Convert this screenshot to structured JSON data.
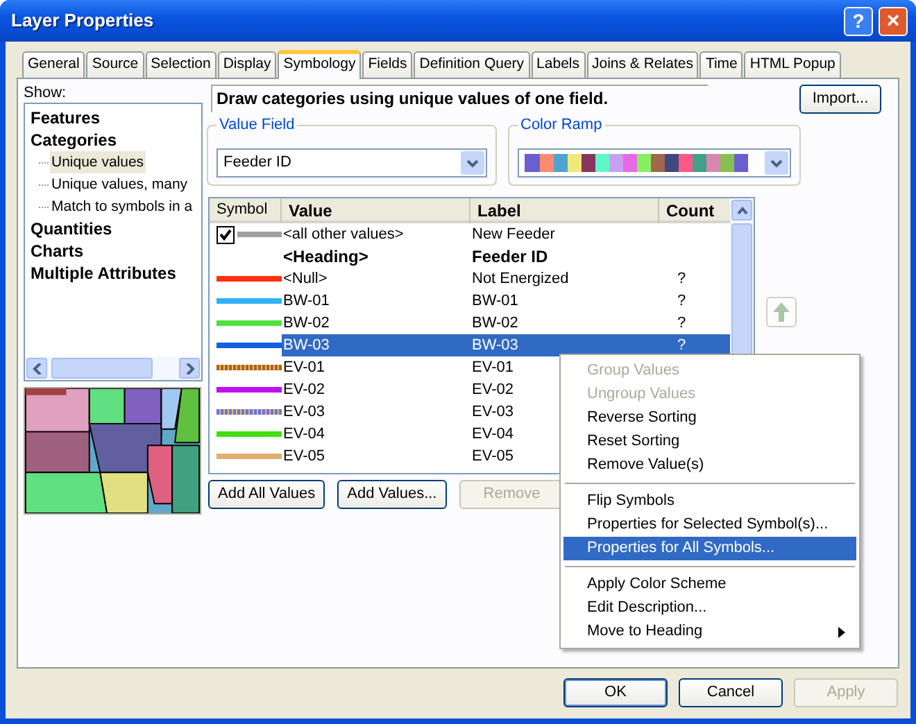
{
  "window": {
    "title": "Layer Properties",
    "help_button": "?",
    "close_button": "×"
  },
  "tabs": [
    {
      "label": "General",
      "selected": false
    },
    {
      "label": "Source",
      "selected": false
    },
    {
      "label": "Selection",
      "selected": false
    },
    {
      "label": "Display",
      "selected": false
    },
    {
      "label": "Symbology",
      "selected": true
    },
    {
      "label": "Fields",
      "selected": false
    },
    {
      "label": "Definition Query",
      "selected": false
    },
    {
      "label": "Labels",
      "selected": false
    },
    {
      "label": "Joins & Relates",
      "selected": false
    },
    {
      "label": "Time",
      "selected": false
    },
    {
      "label": "HTML Popup",
      "selected": false
    }
  ],
  "show": {
    "label": "Show:",
    "tree": [
      {
        "label": "Features",
        "selected": false
      },
      {
        "label": "Categories",
        "selected": false,
        "children": [
          {
            "label": "Unique values",
            "selected": true
          },
          {
            "label": "Unique values, many",
            "selected": false
          },
          {
            "label": "Match to symbols in a",
            "selected": false
          }
        ]
      },
      {
        "label": "Quantities",
        "selected": false
      },
      {
        "label": "Charts",
        "selected": false
      },
      {
        "label": "Multiple Attributes",
        "selected": false
      }
    ]
  },
  "description": "Draw categories using unique values of one field.",
  "import_button": "Import...",
  "value_field": {
    "legend": "Value Field",
    "value": "Feeder ID"
  },
  "color_ramp": {
    "legend": "Color Ramp",
    "swatches": [
      {
        "color": "#6a5fcf"
      },
      {
        "color": "#ff8a70"
      },
      {
        "color": "#4fa3d0"
      },
      {
        "color": "#f0e878"
      },
      {
        "color": "#8a3560"
      },
      {
        "color": "#60f8c8"
      },
      {
        "color": "#c8a0f0"
      },
      {
        "color": "#e868e8"
      },
      {
        "color": "#88f060"
      },
      {
        "color": "#a06848"
      },
      {
        "color": "#404880"
      },
      {
        "color": "#ff5888"
      },
      {
        "color": "#40a088"
      },
      {
        "color": "#d888b0"
      },
      {
        "color": "#88c050"
      },
      {
        "color": "#6a5fcf"
      }
    ]
  },
  "table": {
    "columns": [
      "Symbol",
      "Value",
      "Label",
      "Count"
    ],
    "rows": [
      {
        "kind": "symbol",
        "checked": true,
        "color": "#a0a0a0",
        "textured": false,
        "value": "<all other values>",
        "label": "New Feeder",
        "selected": false
      },
      {
        "kind": "heading",
        "value": "<Heading>",
        "label": "Feeder ID",
        "selected": false
      },
      {
        "kind": "symbol",
        "color": "#ff3010",
        "textured": false,
        "value": "<Null>",
        "label": "Not Energized",
        "count": "?",
        "selected": false
      },
      {
        "kind": "symbol",
        "color": "#30b0f8",
        "textured": false,
        "value": "BW-01",
        "label": "BW-01",
        "count": "?",
        "selected": false
      },
      {
        "kind": "symbol",
        "color": "#50e040",
        "textured": false,
        "value": "BW-02",
        "label": "BW-02",
        "count": "?",
        "selected": false
      },
      {
        "kind": "symbol",
        "color": "#1060e8",
        "textured": false,
        "value": "BW-03",
        "label": "BW-03",
        "count": "?",
        "selected": true
      },
      {
        "kind": "symbol",
        "color": "#b06020",
        "textured": true,
        "value": "EV-01",
        "label": "EV-01",
        "selected": false
      },
      {
        "kind": "symbol",
        "color": "#c010f0",
        "textured": false,
        "value": "EV-02",
        "label": "EV-02",
        "selected": false
      },
      {
        "kind": "symbol",
        "color": "#7070e0",
        "textured": true,
        "value": "EV-03",
        "label": "EV-03",
        "selected": false
      },
      {
        "kind": "symbol",
        "color": "#40e010",
        "textured": false,
        "value": "EV-04",
        "label": "EV-04",
        "selected": false
      },
      {
        "kind": "symbol",
        "color": "#e0b070",
        "textured": false,
        "value": "EV-05",
        "label": "EV-05",
        "selected": false
      }
    ]
  },
  "table_buttons": [
    {
      "label": "Add All Values",
      "disabled": false
    },
    {
      "label": "Add Values...",
      "disabled": false
    },
    {
      "label": "Remove",
      "disabled": true
    }
  ],
  "context_menu": [
    {
      "kind": "item",
      "label": "Group Values",
      "disabled": true,
      "selected": false
    },
    {
      "kind": "item",
      "label": "Ungroup Values",
      "disabled": true,
      "selected": false
    },
    {
      "kind": "item",
      "label": "Reverse Sorting",
      "disabled": false,
      "selected": false
    },
    {
      "kind": "item",
      "label": "Reset Sorting",
      "disabled": false,
      "selected": false
    },
    {
      "kind": "item",
      "label": "Remove Value(s)",
      "disabled": false,
      "selected": false
    },
    {
      "kind": "separator"
    },
    {
      "kind": "item",
      "label": "Flip Symbols",
      "disabled": false,
      "selected": false
    },
    {
      "kind": "item",
      "label": "Properties for Selected Symbol(s)...",
      "disabled": false,
      "selected": false
    },
    {
      "kind": "item",
      "label": "Properties for All Symbols...",
      "disabled": false,
      "selected": true
    },
    {
      "kind": "separator"
    },
    {
      "kind": "item",
      "label": "Apply Color Scheme",
      "disabled": false,
      "selected": false
    },
    {
      "kind": "item",
      "label": "Edit Description...",
      "disabled": false,
      "selected": false
    },
    {
      "kind": "item",
      "label": "Move to Heading",
      "disabled": false,
      "selected": false,
      "submenu": true
    }
  ],
  "dialog_buttons": [
    {
      "label": "OK",
      "disabled": false,
      "default": true
    },
    {
      "label": "Cancel",
      "disabled": false,
      "default": false
    },
    {
      "label": "Apply",
      "disabled": true,
      "default": false
    }
  ]
}
